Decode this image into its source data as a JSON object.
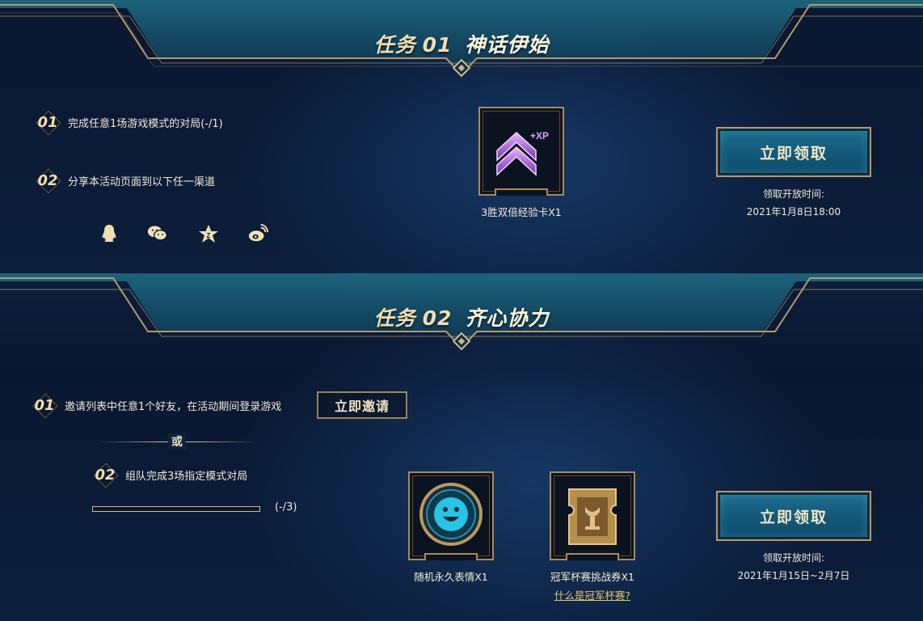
{
  "task1": {
    "label": "任务",
    "number": "01",
    "subtitle": "神话伊始",
    "steps": [
      {
        "num": "01",
        "text": "完成任意1场游戏模式的对局(-/1)"
      },
      {
        "num": "02",
        "text": "分享本活动页面到以下任一渠道"
      }
    ],
    "share_icons": [
      "qq-icon",
      "wechat-icon",
      "qzone-icon",
      "weibo-icon"
    ],
    "reward": {
      "icon": "xp-card-icon",
      "badge": "+XP",
      "label": "3胜双倍经验卡X1"
    },
    "claim": {
      "button": "立即领取",
      "time_label": "领取开放时间:",
      "time": "2021年1月8日18:00"
    }
  },
  "task2": {
    "label": "任务",
    "number": "02",
    "subtitle": "齐心协力",
    "steps": [
      {
        "num": "01",
        "text": "邀请列表中任意1个好友，在活动期间登录游戏"
      },
      {
        "num": "02",
        "text": "组队完成3场指定模式对局"
      }
    ],
    "invite_button": "立即邀请",
    "or_text": "或",
    "progress": {
      "text": "(-/3)",
      "fraction": 0
    },
    "rewards": [
      {
        "icon": "smiley-emote-icon",
        "label": "随机永久表情X1"
      },
      {
        "icon": "cup-ticket-icon",
        "label": "冠军杯赛挑战券X1",
        "link": "什么是冠军杯赛?"
      }
    ],
    "claim": {
      "button": "立即领取",
      "time_label": "领取开放时间:",
      "time": "2021年1月15日~2月7日"
    }
  },
  "colors": {
    "gold": "#cdb98f",
    "teal": "#1f6e8f",
    "background": "#0c1e3b"
  }
}
